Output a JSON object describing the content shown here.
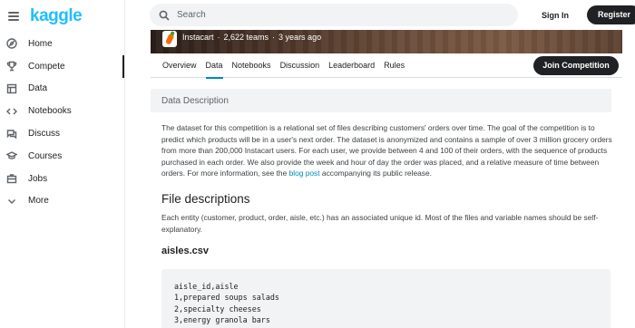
{
  "app": {
    "logo": "kaggle"
  },
  "sidebar": {
    "items": [
      {
        "label": "Home",
        "icon": "compass-icon"
      },
      {
        "label": "Compete",
        "icon": "trophy-icon",
        "active": true
      },
      {
        "label": "Data",
        "icon": "table-icon"
      },
      {
        "label": "Notebooks",
        "icon": "code-icon"
      },
      {
        "label": "Discuss",
        "icon": "comments-icon"
      },
      {
        "label": "Courses",
        "icon": "school-icon"
      },
      {
        "label": "Jobs",
        "icon": "briefcase-icon"
      },
      {
        "label": "More",
        "icon": "chevron-down-icon"
      }
    ]
  },
  "header": {
    "search_placeholder": "Search",
    "sign_in": "Sign In",
    "register": "Register"
  },
  "competition": {
    "host": "Instacart",
    "teams": "2,622 teams",
    "age": "3 years ago",
    "tabs": [
      "Overview",
      "Data",
      "Notebooks",
      "Discussion",
      "Leaderboard",
      "Rules"
    ],
    "active_tab": "Data",
    "join_label": "Join Competition"
  },
  "main": {
    "section_title": "Data Description",
    "description_pre": "The dataset for this competition is a relational set of files describing customers' orders over time. The goal of the competition is to predict which products will be in a user's next order. The dataset is anonymized and contains a sample of over 3 million grocery orders from more than 200,000 Instacart users. For each user, we provide between 4 and 100 of their orders, with the sequence of products purchased in each order. We also provide the week and hour of day the order was placed, and a relative measure of time between orders. For more information, see the ",
    "description_link": "blog post",
    "description_post": " accompanying its public release.",
    "file_descriptions_heading": "File descriptions",
    "file_descriptions_text": "Each entity (customer, product, order, aisle, etc.) has an associated unique id. Most of the files and variable names should be self-explanatory.",
    "aisles_heading": "aisles.csv",
    "aisles_code": [
      "aisle_id,aisle",
      "1,prepared soups salads",
      "2,specialty cheeses",
      "3,energy granola bars"
    ]
  },
  "colors": {
    "brand": "#20beff",
    "accent": "#008abc",
    "dark": "#202124"
  }
}
